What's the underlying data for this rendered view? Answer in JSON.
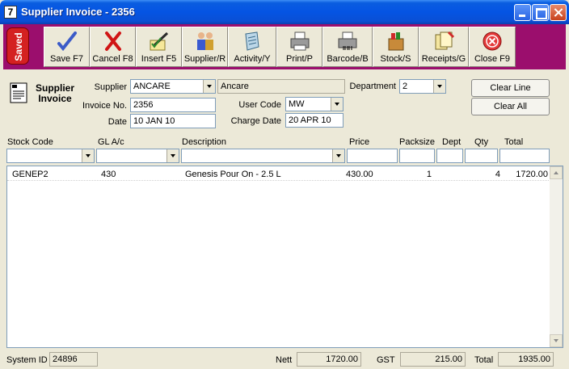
{
  "window": {
    "icon_glyph": "7",
    "title": "Supplier Invoice - 2356"
  },
  "toolbar": {
    "saved_label": "Saved",
    "buttons": [
      {
        "label": "Save F7",
        "icon": "pen-check-icon"
      },
      {
        "label": "Cancel F8",
        "icon": "red-x-icon"
      },
      {
        "label": "Insert F5",
        "icon": "insert-pen-icon"
      },
      {
        "label": "Supplier/R",
        "icon": "people-icon"
      },
      {
        "label": "Activity/Y",
        "icon": "scroll-icon"
      },
      {
        "label": "Print/P",
        "icon": "printer-icon"
      },
      {
        "label": "Barcode/B",
        "icon": "barcode-printer-icon"
      },
      {
        "label": "Stock/S",
        "icon": "stock-box-icon"
      },
      {
        "label": "Receipts/G",
        "icon": "receipts-icon"
      },
      {
        "label": "Close F9",
        "icon": "close-circle-icon"
      }
    ]
  },
  "form": {
    "title_line1": "Supplier",
    "title_line2": "Invoice",
    "supplier_label": "Supplier",
    "supplier_code": "ANCARE",
    "supplier_name": "Ancare",
    "invoice_no_label": "Invoice No.",
    "invoice_no": "2356",
    "date_label": "Date",
    "date": "10 JAN 10",
    "user_code_label": "User Code",
    "user_code": "MW",
    "charge_date_label": "Charge Date",
    "charge_date": "20 APR 10",
    "department_label": "Department",
    "department": "2",
    "clear_line_label": "Clear Line",
    "clear_all_label": "Clear All"
  },
  "grid": {
    "headers": {
      "stock_code": "Stock Code",
      "gl_ac": "GL A/c",
      "description": "Description",
      "price": "Price",
      "packsize": "Packsize",
      "dept": "Dept",
      "qty": "Qty",
      "total": "Total"
    },
    "rows": [
      {
        "stock_code": "GENEP2",
        "gl_ac": "430",
        "description": "Genesis Pour On - 2.5 L",
        "price": "430.00",
        "packsize": "1",
        "dept": "",
        "qty": "4",
        "total": "1720.00"
      }
    ]
  },
  "status": {
    "system_id_label": "System ID",
    "system_id": "24896",
    "nett_label": "Nett",
    "nett": "1720.00",
    "gst_label": "GST",
    "gst": "215.00",
    "total_label": "Total",
    "total": "1935.00"
  },
  "colors": {
    "toolbar_bg": "#9b0e6d",
    "saved_badge": "#d42121",
    "window_bg": "#ece9d8",
    "title_bar": "#0554e3"
  }
}
